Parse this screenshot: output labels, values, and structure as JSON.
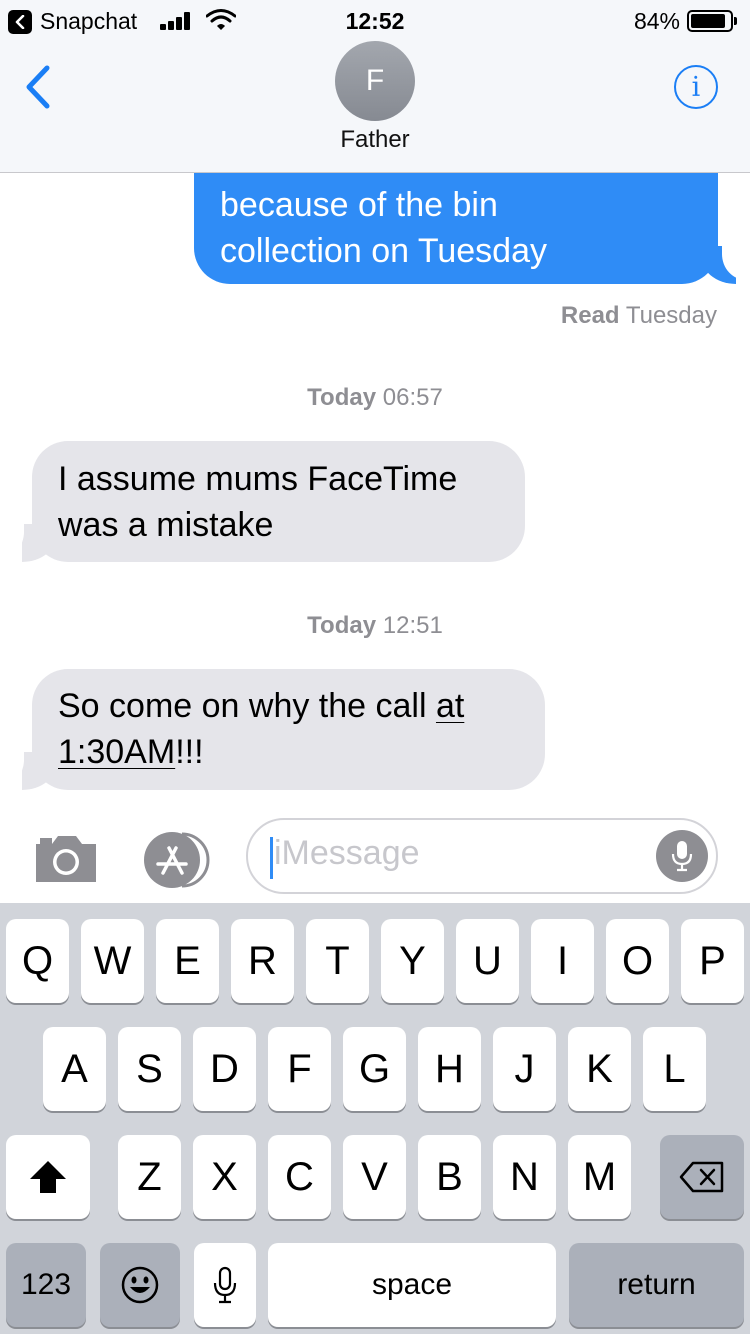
{
  "status_bar": {
    "back_app": "Snapchat",
    "time": "12:52",
    "battery": "84%"
  },
  "header": {
    "avatar_initial": "F",
    "contact_name": "Father",
    "info_label": "i"
  },
  "thread": {
    "outgoing_1": {
      "lines": [
        "because of the bin",
        "collection on Tuesday"
      ]
    },
    "read_receipt": {
      "label": "Read",
      "day": "Tuesday"
    },
    "timestamp_1": {
      "day": "Today",
      "time": "06:57"
    },
    "incoming_1": {
      "lines": [
        "I assume mums FaceTime",
        "was a mistake"
      ]
    },
    "timestamp_2": {
      "day": "Today",
      "time": "12:51"
    },
    "incoming_2": {
      "line1_plain": "So come on why the call ",
      "line1_link": "at",
      "line2_link": "1:30AM",
      "line2_plain": "!!!"
    }
  },
  "input": {
    "placeholder": "iMessage"
  },
  "keyboard": {
    "row1": [
      "Q",
      "W",
      "E",
      "R",
      "T",
      "Y",
      "U",
      "I",
      "O",
      "P"
    ],
    "row2": [
      "A",
      "S",
      "D",
      "F",
      "G",
      "H",
      "J",
      "K",
      "L"
    ],
    "row3": [
      "Z",
      "X",
      "C",
      "V",
      "B",
      "N",
      "M"
    ],
    "numbers_key": "123",
    "space_key": "space",
    "return_key": "return"
  },
  "colors": {
    "accent": "#1a7ef5",
    "outgoing_bubble": "#2f8cf6",
    "incoming_bubble": "#e5e5ea",
    "keyboard_bg": "#d1d4da"
  },
  "icons": [
    "back-chevron-icon",
    "info-icon",
    "camera-icon",
    "app-store-icon",
    "microphone-icon",
    "shift-icon",
    "emoji-icon",
    "dictation-icon",
    "delete-icon"
  ]
}
